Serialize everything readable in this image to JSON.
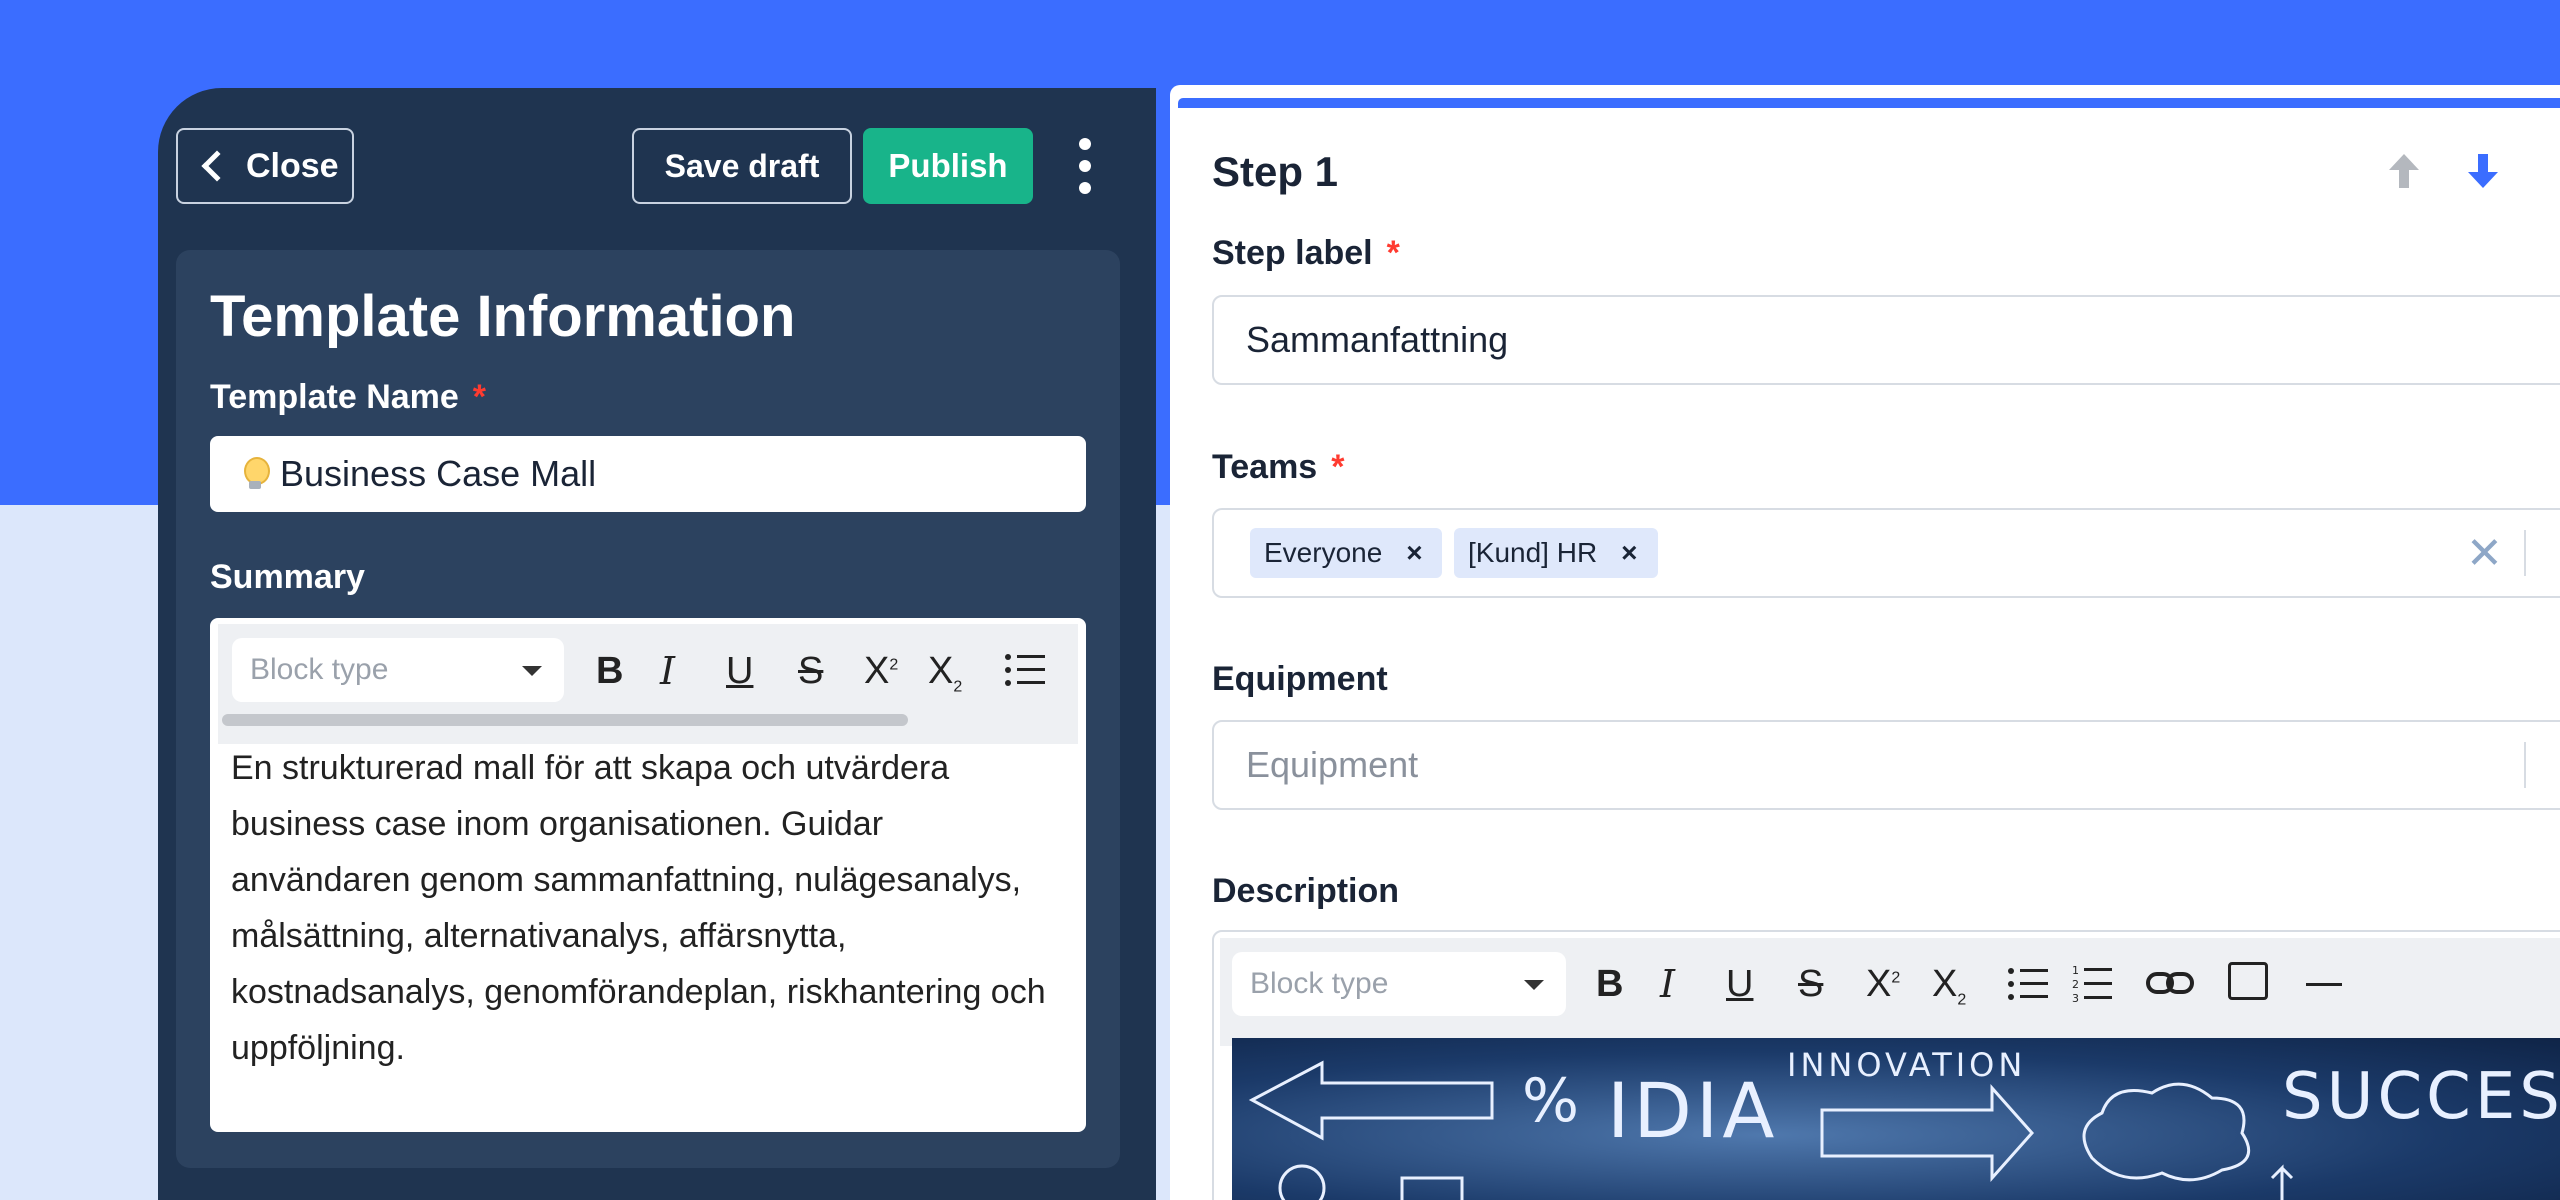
{
  "header": {
    "close_label": "Close",
    "save_draft_label": "Save draft",
    "publish_label": "Publish"
  },
  "template_info": {
    "title": "Template Information",
    "name_label": "Template Name",
    "required_mark": "*",
    "name_value": "Business Case Mall",
    "summary_label": "Summary",
    "block_type_placeholder": "Block type",
    "summary_text": "En strukturerad mall för att skapa och utvärdera business case inom organisationen. Guidar användaren genom sammanfattning, nulägesanalys, målsättning, alternativanalys, affärsnytta, kostnadsanalys, genomförandeplan, riskhantering och uppföljning."
  },
  "step": {
    "title": "Step 1",
    "step_label_label": "Step label",
    "step_label_value": "Sammanfattning",
    "teams_label": "Teams",
    "teams_chips": [
      "Everyone",
      "[Kund] HR"
    ],
    "chip_remove": "×",
    "clear_glyph": "✕",
    "equipment_label": "Equipment",
    "equipment_placeholder": "Equipment",
    "description_label": "Description",
    "block_type_placeholder": "Block type",
    "image_words": [
      "%",
      "IDIA",
      "INNOVATION",
      "SUCCESS"
    ]
  },
  "toolbar": {
    "bold": "B",
    "italic": "I",
    "underline": "U",
    "strike": "S",
    "superscript": "X",
    "subscript": "X",
    "sup_mark": "2",
    "sub_mark": "2"
  },
  "colors": {
    "brand_blue": "#3b6dff",
    "panel_dark": "#1f3450",
    "publish_green": "#18b48a",
    "required_red": "#ff3b30"
  },
  "icons": [
    "chevron-left-icon",
    "kebab-menu-icon",
    "lightbulb-icon",
    "arrow-up-icon",
    "arrow-down-icon",
    "bullet-list-icon",
    "numbered-list-icon",
    "link-icon",
    "image-icon",
    "horizontal-rule-icon",
    "close-icon",
    "chevron-down-icon"
  ]
}
